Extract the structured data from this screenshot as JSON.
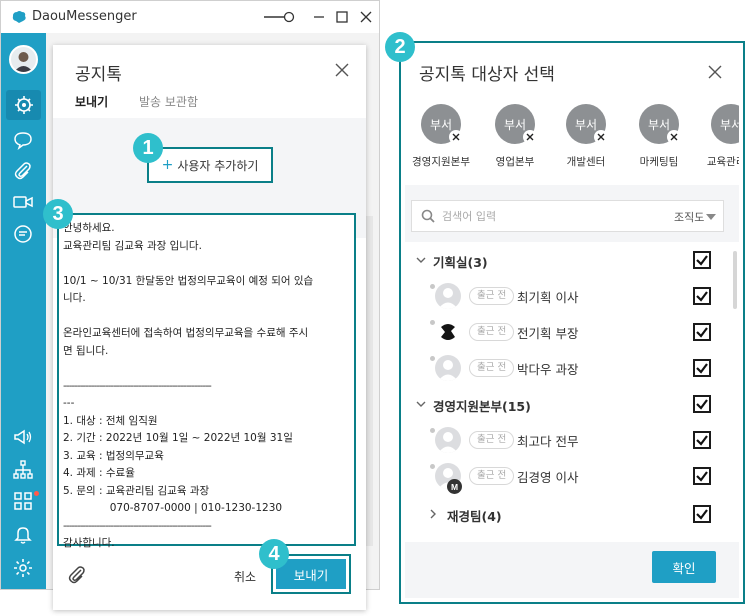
{
  "app": {
    "title": "DaouMessenger"
  },
  "compose": {
    "title": "공지톡",
    "tabs": [
      {
        "label": "보내기"
      },
      {
        "label": "발송 보관함"
      }
    ],
    "add_user_label": "사용자 추가하기",
    "message_lines": [
      "안녕하세요.",
      "교육관리팀 김교육 과장 입니다.",
      "",
      "10/1 ~ 10/31 한달동안 법정의무교육이 예정 되어 있습",
      "니다.",
      "",
      "온라인교육센터에 접속하여 법정의무교육을 수료해 주시",
      "면 됩니다.",
      "",
      "-----------------------------------------------------",
      "---",
      "1. 대상 : 전체 임직원",
      "2. 기간 : 2022년 10월 1일 ~ 2022년 10월 31일",
      "3. 교육 : 법정의무교육",
      "4. 과제 : 수료율",
      "5. 문의 : 교육관리팀 김교육 과장",
      "              070-8707-0000 | 010-1230-1230",
      "-----------------------------------------------------",
      "감사합니다."
    ],
    "cancel_label": "취소",
    "send_label": "보내기"
  },
  "badges": {
    "b1": "1",
    "b2": "2",
    "b3": "3",
    "b4": "4"
  },
  "dialog": {
    "title": "공지톡 대상자 선택",
    "chips": [
      {
        "avatar": "부서",
        "label": "경영지원본부"
      },
      {
        "avatar": "부서",
        "label": "영업본부"
      },
      {
        "avatar": "부서",
        "label": "개발센터"
      },
      {
        "avatar": "부서",
        "label": "마케팅팀"
      },
      {
        "avatar": "부서",
        "label": "교육관리팀"
      }
    ],
    "search_placeholder": "검색어 입력",
    "org_select": "조직도",
    "tree": [
      {
        "kind": "group",
        "name": "기획실(3)",
        "expanded": true,
        "checked": true
      },
      {
        "kind": "person",
        "status": "출근 전",
        "name": "최기획 이사",
        "checked": true,
        "avatar": "default"
      },
      {
        "kind": "person",
        "status": "출근 전",
        "name": "전기획 부장",
        "checked": true,
        "avatar": "logo"
      },
      {
        "kind": "person",
        "status": "출근 전",
        "name": "박다우 과장",
        "checked": true,
        "avatar": "default"
      },
      {
        "kind": "group",
        "name": "경영지원본부(15)",
        "expanded": true,
        "checked": true
      },
      {
        "kind": "person",
        "status": "출근 전",
        "name": "최고다 전무",
        "checked": true,
        "avatar": "default"
      },
      {
        "kind": "person",
        "status": "출근 전",
        "name": "김경영 이사",
        "checked": true,
        "avatar": "default",
        "badge": "M"
      },
      {
        "kind": "subgroup",
        "name": "재경팀(4)",
        "expanded": false,
        "checked": true
      }
    ],
    "confirm_label": "확인"
  },
  "colors": {
    "accent": "#1f9fc5",
    "highlight": "#0a7f88",
    "badge": "#2fbfcc",
    "sidebar": "#1f9fc5"
  }
}
